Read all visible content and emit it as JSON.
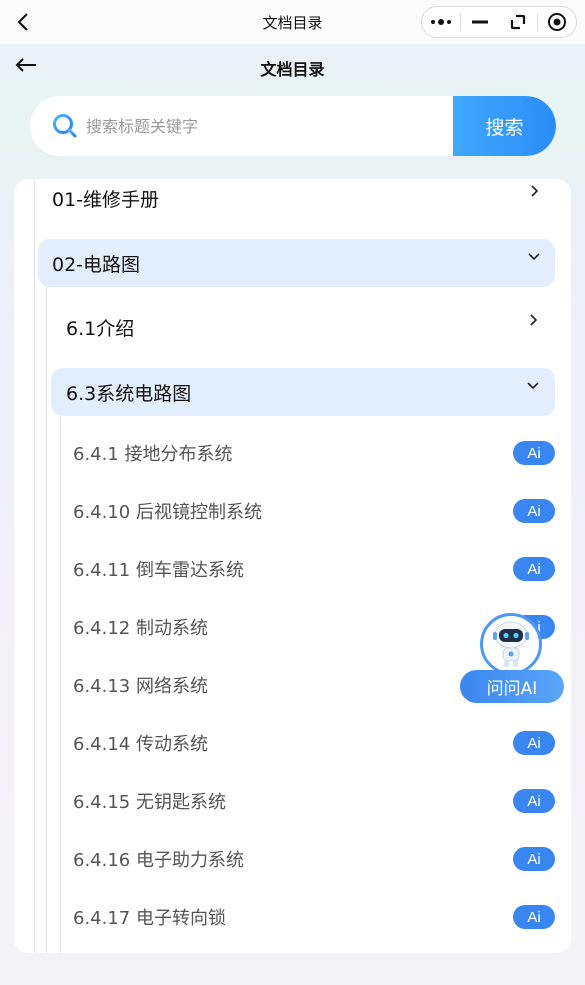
{
  "topbar": {
    "title": "文档目录"
  },
  "header": {
    "title": "文档目录"
  },
  "search": {
    "placeholder": "搜索标题关键字",
    "button_label": "搜索"
  },
  "tree": {
    "level1": [
      {
        "label": "01-维修手册",
        "expanded": false
      },
      {
        "label": "02-电路图",
        "expanded": true
      }
    ],
    "level2": [
      {
        "label": "6.1介绍",
        "expanded": false
      },
      {
        "label": "6.3系统电路图",
        "expanded": true
      }
    ],
    "leaves": [
      {
        "label": "6.4.1 接地分布系统",
        "badge": "Ai"
      },
      {
        "label": "6.4.10 后视镜控制系统",
        "badge": "Ai"
      },
      {
        "label": "6.4.11 倒车雷达系统",
        "badge": "Ai"
      },
      {
        "label": "6.4.12 制动系统",
        "badge": "Ai"
      },
      {
        "label": "6.4.13 网络系统",
        "badge": "Ai"
      },
      {
        "label": "6.4.14 传动系统",
        "badge": "Ai"
      },
      {
        "label": "6.4.15 无钥匙系统",
        "badge": "Ai"
      },
      {
        "label": "6.4.16 电子助力系统",
        "badge": "Ai"
      },
      {
        "label": "6.4.17 电子转向锁",
        "badge": "Ai"
      }
    ]
  },
  "floating": {
    "ask_ai_label": "问问AI"
  },
  "colors": {
    "accent": "#3a86f0",
    "active_row": "#e3eefc",
    "search_button": "#2b8cf7"
  }
}
